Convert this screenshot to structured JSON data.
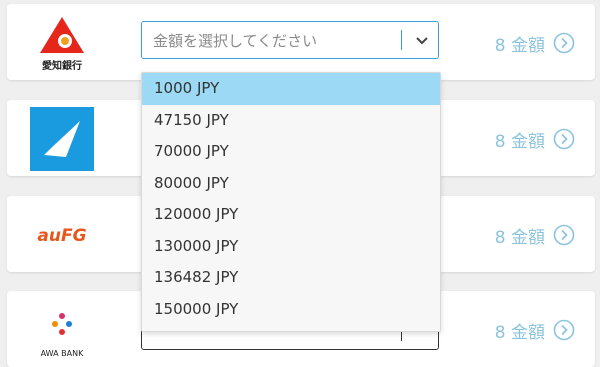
{
  "select": {
    "placeholder": "金額を選択してください"
  },
  "dropdown_options": [
    "1000 JPY",
    "47150 JPY",
    "70000 JPY",
    "80000 JPY",
    "120000 JPY",
    "130000 JPY",
    "136482 JPY",
    "150000 JPY"
  ],
  "dropdown_highlighted": "1000 JPY",
  "banks": [
    {
      "logo_text": "愛知銀行",
      "amount_label": "8 金額"
    },
    {
      "logo_text": "",
      "amount_label": "8 金額"
    },
    {
      "logo_text": "auFG",
      "amount_label": "8 金額"
    },
    {
      "logo_text": "AWA BANK",
      "amount_label": "8 金額"
    }
  ],
  "colors": {
    "accent": "#3ba0d3",
    "amount_link": "#8dc4dd",
    "highlight": "#9bd9f5"
  }
}
